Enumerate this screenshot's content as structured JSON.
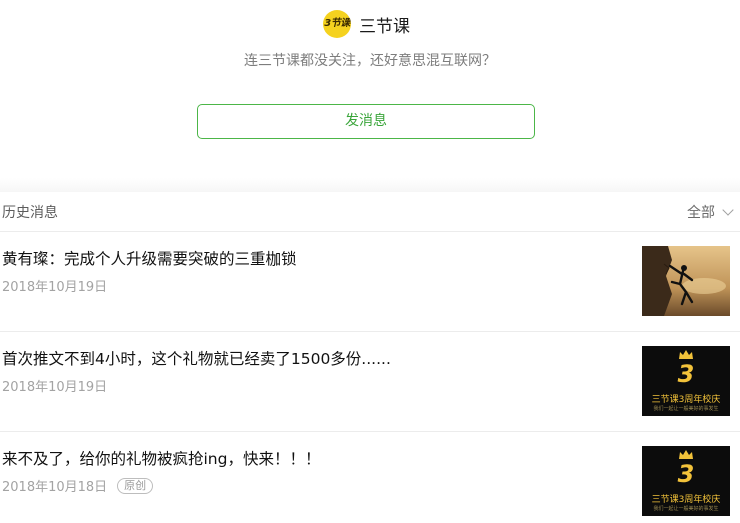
{
  "account": {
    "logo_text": "3节课",
    "name": "三节课",
    "tagline": "连三节课都没关注，还好意思混互联网？",
    "send_button": "发消息"
  },
  "history": {
    "title": "历史消息",
    "filter_label": "全部",
    "filter_icon": "chevron-down-icon"
  },
  "articles": [
    {
      "title": "黄有璨：完成个人升级需要突破的三重枷锁",
      "date": "2018年10月19日",
      "thumbnail": "climber-silhouette-image"
    },
    {
      "title": "首次推文不到4小时，这个礼物就已经卖了1500多份......",
      "date": "2018年10月19日",
      "thumbnail": "anniversary-poster-image",
      "thumb_num": "3",
      "thumb_text": "三节课3周年校庆",
      "thumb_sub": "我们一起让一般美好的事发生"
    },
    {
      "title": "来不及了，给你的礼物被疯抢ing，快来！！！",
      "date": "2018年10月18日",
      "badge": "原创",
      "thumbnail": "anniversary-poster-image",
      "thumb_num": "3",
      "thumb_text": "三节课3周年校庆",
      "thumb_sub": "我们一起让一般美好的事发生"
    }
  ],
  "colors": {
    "accent_green": "#4cb648",
    "logo_yellow": "#f5d21f",
    "poster_gold": "#f2c23a"
  }
}
